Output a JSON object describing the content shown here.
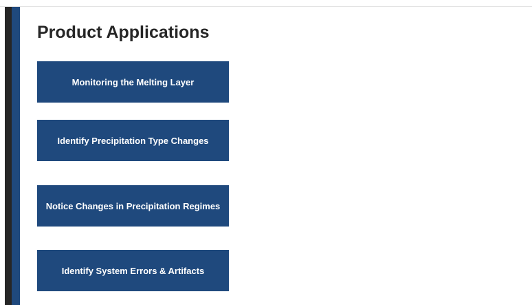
{
  "page": {
    "title": "Product Applications"
  },
  "applications": [
    {
      "label": "Monitoring the Melting Layer"
    },
    {
      "label": "Identify Precipitation Type Changes"
    },
    {
      "label": "Notice Changes in Precipitation Regimes"
    },
    {
      "label": "Identify System Errors & Artifacts"
    }
  ],
  "colors": {
    "accent": "#1f497d",
    "side_dark": "#262626",
    "title_text": "#262626",
    "button_text": "#ffffff",
    "background": "#ffffff"
  }
}
